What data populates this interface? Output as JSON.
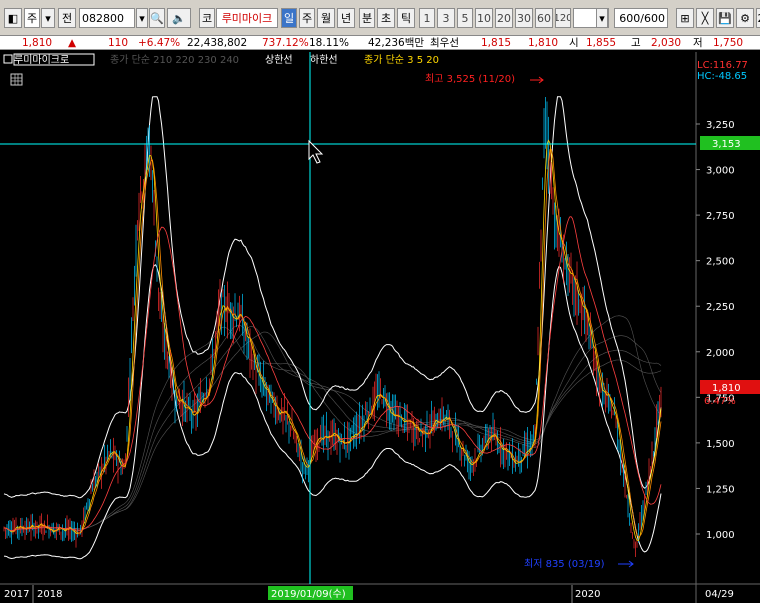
{
  "toolbar": {
    "market_select": "주",
    "jeon_label": "전",
    "stock_code": "082800",
    "ko_label": "코",
    "stock_name": "루미마이크",
    "periods": [
      "일",
      "주",
      "월",
      "년",
      "분",
      "초",
      "틱"
    ],
    "active_period": "일",
    "intervals": [
      "1",
      "3",
      "5",
      "10",
      "20",
      "30",
      "60",
      "120"
    ],
    "count_display": "600/600",
    "extra_label": "2"
  },
  "quote": {
    "price": "1,810",
    "change": "110",
    "change_pct": "+6.47%",
    "volume": "22,438,802",
    "volume_ratio": "737.12%",
    "turnover": "18.11%",
    "amount": "42,236백만",
    "best_ask_label": "최우선",
    "best_ask": "1,815",
    "best_bid": "1,810",
    "open_label": "시",
    "open": "1,855",
    "high_label": "고",
    "high": "2,030",
    "low_label": "저",
    "low": "1,750"
  },
  "chart": {
    "legend": {
      "name": "루미마이크로",
      "ma_long": "종가 단순 210 220 230 240",
      "upper_limit": "상한선",
      "lower_limit": "하한선",
      "ma_short": "종가 단순 3  5  20"
    },
    "indicators": {
      "lc": "LC:116.77",
      "hc": "HC:-48.65"
    },
    "annotations": {
      "high_mark": "최고 3,525 (11/20)",
      "low_mark": "최저 835 (03/19)"
    },
    "crosshair": {
      "price_label": "3,153",
      "date_label": "2019/01/09(수)"
    },
    "current_price": {
      "price": "1,810",
      "pct": "6.47%"
    },
    "y_ticks": [
      "3,250",
      "3,000",
      "2,750",
      "2,500",
      "2,250",
      "2,000",
      "1,750",
      "1,500",
      "1,250",
      "1,000"
    ],
    "x_ticks": [
      "2017",
      "2018",
      "2020",
      "04/29"
    ],
    "colors": {
      "up": "#ff3030",
      "down": "#00c8ff",
      "ma3": "#ffd700",
      "ma5": "#ff8c00",
      "envelope": "#ffffff",
      "crosshair": "#00ffff"
    }
  },
  "chart_data": {
    "type": "line",
    "title": "",
    "x": [
      "2017",
      "2018",
      "2019/01/09(수)",
      "2020",
      "04/29"
    ],
    "series": [
      {
        "values": [
          1050,
          1200,
          3153,
          2800,
          1810
        ]
      }
    ],
    "ylim": [
      800,
      3400
    ],
    "y_ticks": [
      1000,
      1250,
      1500,
      1750,
      2000,
      2250,
      2500,
      2750,
      3000,
      3250
    ],
    "grid": false,
    "legend": "top-left"
  }
}
